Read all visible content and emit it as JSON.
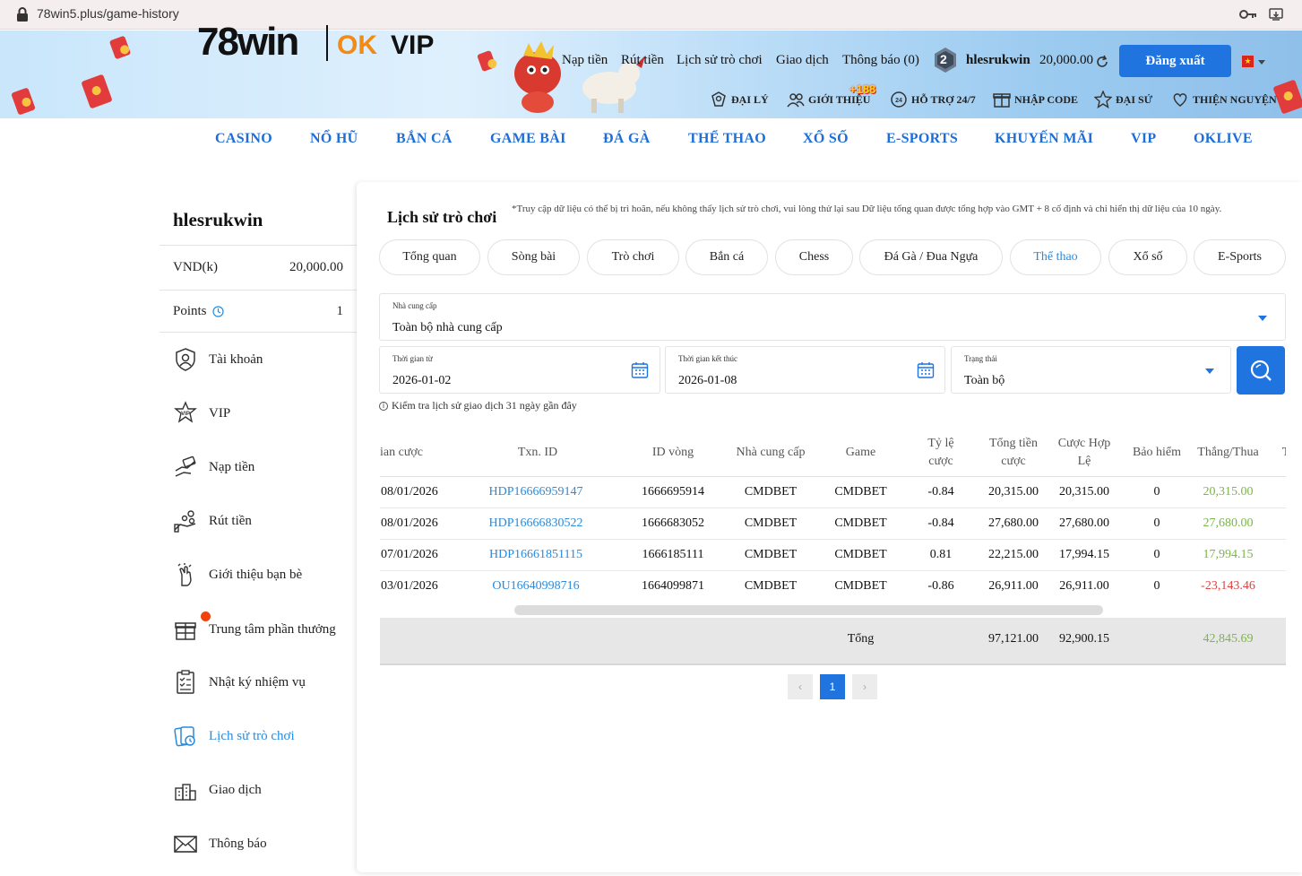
{
  "browser": {
    "url": "78win5.plus/game-history"
  },
  "header": {
    "logo_78": "78win",
    "logo_ok": "OK",
    "logo_vip": "VIP",
    "top_links": [
      "Nạp tiền",
      "Rút tiền",
      "Lịch sử trò chơi",
      "Giao dịch",
      "Thông báo (0)"
    ],
    "level": "2",
    "username": "hlesrukwin",
    "balance": "20,000.00",
    "logout_label": "Đăng xuất",
    "flag_symbol": "★",
    "promo_badge": "+188",
    "sub_links": [
      "ĐẠI LÝ",
      "GIỚI THIỆU",
      "HỖ TRỢ 24/7",
      "NHẬP CODE",
      "ĐẠI SỨ",
      "THIỆN NGUYỆN"
    ],
    "sub_icons": [
      "agent-icon",
      "referral-icon",
      "support-icon",
      "gift-code-icon",
      "ambassador-icon",
      "charity-icon"
    ],
    "accent_color": "#1f74e0"
  },
  "main_menu": [
    "CASINO",
    "NỔ HŨ",
    "BẮN CÁ",
    "GAME BÀI",
    "ĐÁ GÀ",
    "THỂ THAO",
    "XỔ SỐ",
    "E-SPORTS",
    "KHUYẾN MÃI",
    "VIP",
    "OKLIVE"
  ],
  "sidebar": {
    "username": "hlesrukwin",
    "currency_label": "VND(k)",
    "currency_value": "20,000.00",
    "points_label": "Points",
    "points_value": "1",
    "items": [
      {
        "label": "Tài khoản",
        "icon": "account-shield-icon"
      },
      {
        "label": "VIP",
        "icon": "vip-star-icon"
      },
      {
        "label": "Nạp tiền",
        "icon": "deposit-icon"
      },
      {
        "label": "Rút tiền",
        "icon": "withdraw-icon"
      },
      {
        "label": "Giới thiệu bạn bè",
        "icon": "refer-friend-icon"
      },
      {
        "label": "Trung tâm phần thưởng",
        "icon": "reward-gift-icon"
      },
      {
        "label": "Nhật ký nhiệm vụ",
        "icon": "task-log-icon"
      },
      {
        "label": "Lịch sử trò chơi",
        "icon": "game-history-icon",
        "active": true
      },
      {
        "label": "Giao dịch",
        "icon": "transaction-icon"
      },
      {
        "label": "Thông báo",
        "icon": "mail-icon"
      }
    ]
  },
  "panel": {
    "title": "Lịch sử trò chơi",
    "note": "*Truy cập dữ liệu có thể bị trì hoãn, nếu không thấy lịch sử trò chơi, vui lòng thử lại sau Dữ liệu tổng quan được tổng hợp vào GMT + 8 cố định và chỉ hiển thị dữ liệu của 10 ngày.",
    "tabs": [
      "Tổng quan",
      "Sòng bài",
      "Trò chơi",
      "Bắn cá",
      "Chess",
      "Đá Gà / Đua Ngựa",
      "Thể thao",
      "Xổ số",
      "E-Sports"
    ],
    "active_tab": "Thể thao",
    "provider": {
      "label": "Nhà cung cấp",
      "value": "Toàn bộ nhà cung cấp"
    },
    "date_from": {
      "label": "Thời gian từ",
      "value": "2026-01-02"
    },
    "date_to": {
      "label": "Thời gian kết thúc",
      "value": "2026-01-08"
    },
    "status": {
      "label": "Trạng thái",
      "value": "Toàn bộ"
    },
    "hint": "Kiểm tra lịch sử giao dịch 31 ngày gần đây"
  },
  "table": {
    "columns": [
      "ian cược",
      "Txn. ID",
      "ID vòng",
      "Nhà cung cấp",
      "Game",
      "Tỷ lệ cược",
      "Tổng tiền cược",
      "Cược Hợp Lệ",
      "Bảo hiểm",
      "Thắng/Thua",
      "T"
    ],
    "rows": [
      {
        "date": "08/01/2026",
        "txn": "HDP16666959147",
        "round": "1666695914",
        "provider": "CMDBET",
        "game": "CMDBET",
        "odds": "-0.84",
        "total": "20,315.00",
        "valid": "20,315.00",
        "insurance": "0",
        "winloss": "20,315.00",
        "sign": "pos"
      },
      {
        "date": "08/01/2026",
        "txn": "HDP16666830522",
        "round": "1666683052",
        "provider": "CMDBET",
        "game": "CMDBET",
        "odds": "-0.84",
        "total": "27,680.00",
        "valid": "27,680.00",
        "insurance": "0",
        "winloss": "27,680.00",
        "sign": "pos"
      },
      {
        "date": "07/01/2026",
        "txn": "HDP16661851115",
        "round": "1666185111",
        "provider": "CMDBET",
        "game": "CMDBET",
        "odds": "0.81",
        "total": "22,215.00",
        "valid": "17,994.15",
        "insurance": "0",
        "winloss": "17,994.15",
        "sign": "pos"
      },
      {
        "date": "03/01/2026",
        "txn": "OU16640998716",
        "round": "1664099871",
        "provider": "CMDBET",
        "game": "CMDBET",
        "odds": "-0.86",
        "total": "26,911.00",
        "valid": "26,911.00",
        "insurance": "0",
        "winloss": "-23,143.46",
        "sign": "neg"
      }
    ],
    "total_label": "Tổng",
    "total_bet": "97,121.00",
    "total_valid": "92,900.15",
    "total_winloss": "42,845.69"
  },
  "pagination": {
    "prev": "‹",
    "current": "1",
    "next": "›"
  }
}
